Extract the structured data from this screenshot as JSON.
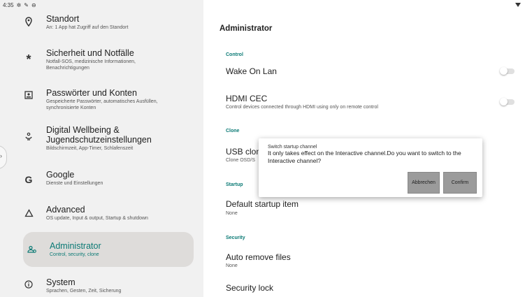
{
  "status_bar": {
    "time": "4:35"
  },
  "sidebar": {
    "items": [
      {
        "title": "Standort",
        "subtitle": "An: 1 App hat Zugriff auf den Standort",
        "icon": "location-pin-icon"
      },
      {
        "title": "Sicherheit und Notfälle",
        "subtitle": "Notfall-SOS, medizinische Informationen, Benachrichtigungen",
        "icon": "asterisk-icon"
      },
      {
        "title": "Passwörter und Konten",
        "subtitle": "Gespeicherte Passwörter, automatisches Ausfüllen, synchronisierte Konten",
        "icon": "account-box-icon"
      },
      {
        "title": "Digital Wellbeing & Jugendschutzeinstellungen",
        "subtitle": "Bildschirmzeit, App-Timer, Schlafenszeit",
        "icon": "wellbeing-icon"
      },
      {
        "title": "Google",
        "subtitle": "Dienste und Einstellungen",
        "icon": "google-icon"
      },
      {
        "title": "Advanced",
        "subtitle": "OS update, Input & output, Startup & shutdown",
        "icon": "house-outline-icon"
      },
      {
        "title": "Administrator",
        "subtitle": "Control, security, clone",
        "icon": "admin-users-icon"
      },
      {
        "title": "System",
        "subtitle": "Sprachen, Gesten, Zeit, Sicherung",
        "icon": "info-icon"
      }
    ]
  },
  "main": {
    "title": "Administrator",
    "sections": {
      "control": "Control",
      "clone": "Clone",
      "startup": "Startup",
      "security": "Security"
    },
    "rows": {
      "wake_on_lan": {
        "title": "Wake On Lan"
      },
      "hdmi_cec": {
        "title": "HDMI CEC",
        "subtitle": "Control devices connected through HDMI using only on remote control"
      },
      "usb_clone": {
        "title": "USB clon",
        "subtitle": "Clone OSD/S"
      },
      "default_startup": {
        "title": "Default startup item",
        "subtitle": "None"
      },
      "auto_remove": {
        "title": "Auto remove files",
        "subtitle": "None"
      },
      "security_lock": {
        "title": "Security lock"
      }
    }
  },
  "dialog": {
    "title": "Switch startup channel",
    "message": "It only takes effect on the Interactive channel.Do you want to switch to the Interactive channel?",
    "cancel_label": "Abbrechen",
    "confirm_label": "Confirm"
  },
  "colors": {
    "accent": "#0b7a75",
    "sidebar_bg": "#f1f1f1",
    "selected_bg": "#dedcda",
    "button_bg": "#9b9b9b"
  }
}
